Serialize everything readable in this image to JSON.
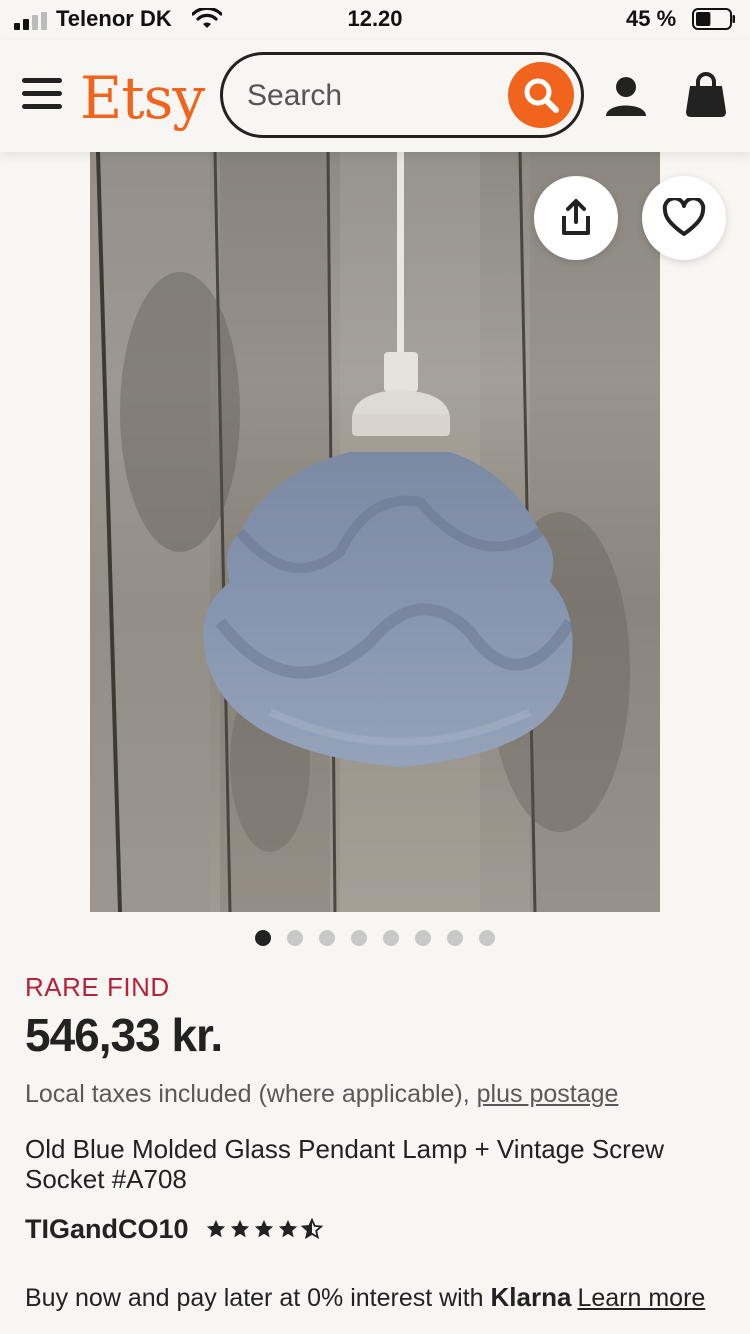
{
  "status_bar": {
    "carrier": "Telenor DK",
    "time": "12.20",
    "battery_percent": "45 %",
    "battery_level": 0.45
  },
  "header": {
    "logo": "Etsy",
    "search_placeholder": "Search",
    "icons": [
      "menu-icon",
      "search-icon",
      "user-icon",
      "bag-icon"
    ],
    "accent_color": "#f1641e"
  },
  "gallery": {
    "image_count": 8,
    "active_index": 0,
    "actions": [
      "share-icon",
      "heart-icon"
    ]
  },
  "product": {
    "badge": "RARE FIND",
    "badge_color": "#b8213c",
    "price": "546,33 kr.",
    "tax_text": "Local taxes included (where applicable), ",
    "postage_link": "plus postage",
    "title": "Old Blue Molded Glass Pendant Lamp + Vintage Screw Socket #A708",
    "shop_name": "TIGandCO10",
    "rating": 4.5,
    "rating_max": 5
  },
  "payment": {
    "text": "Buy now and pay later at 0% interest with ",
    "provider": "Klarna",
    "learn_more": "Learn more"
  }
}
